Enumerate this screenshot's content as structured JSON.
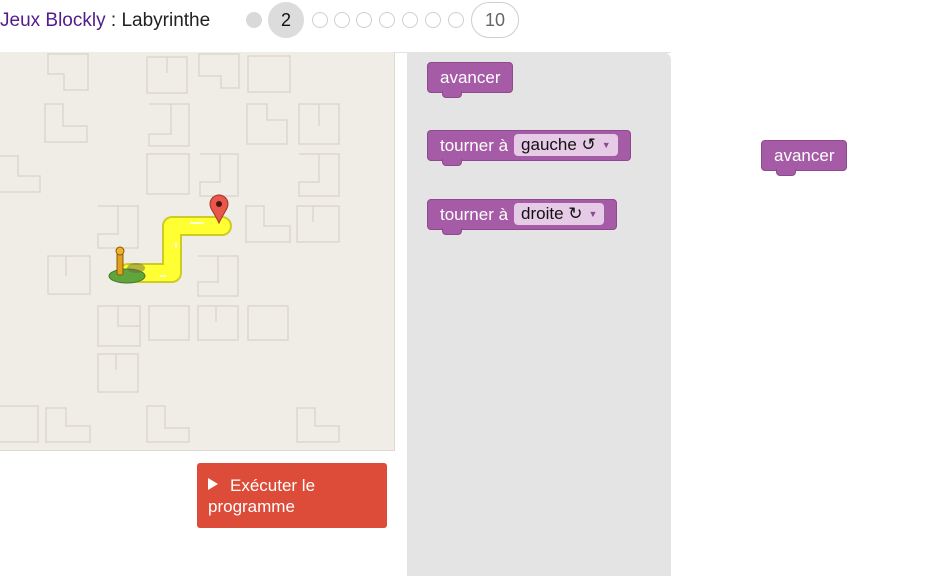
{
  "header": {
    "app_name": "Jeux Blockly",
    "separator": " : ",
    "game_name": "Labyrinthe",
    "levels": [
      {
        "label": "",
        "state": "done"
      },
      {
        "label": "2",
        "state": "current"
      },
      {
        "label": "",
        "state": "todo"
      },
      {
        "label": "",
        "state": "todo"
      },
      {
        "label": "",
        "state": "todo"
      },
      {
        "label": "",
        "state": "todo"
      },
      {
        "label": "",
        "state": "todo"
      },
      {
        "label": "",
        "state": "todo"
      },
      {
        "label": "",
        "state": "todo"
      },
      {
        "label": "10",
        "state": "last"
      }
    ]
  },
  "maze": {
    "start_icon": "pegman-icon",
    "goal_icon": "map-marker-icon",
    "path_color": "#ffff33",
    "goal_color": "#e8574a"
  },
  "run_button": {
    "icon": "play-icon",
    "label": "Exécuter le programme",
    "color": "#dd4b39"
  },
  "toolbox": {
    "blocks": [
      {
        "label": "avancer"
      },
      {
        "label": "tourner à",
        "dropdown": "gauche ↺"
      },
      {
        "label": "tourner à",
        "dropdown": "droite ↻"
      }
    ]
  },
  "workspace": {
    "blocks": [
      {
        "label": "avancer"
      }
    ]
  },
  "colors": {
    "block": "#a55ba5",
    "maze_bg": "#f0ede6",
    "toolbox_bg": "#e4e4e4",
    "link": "#551a8b"
  }
}
